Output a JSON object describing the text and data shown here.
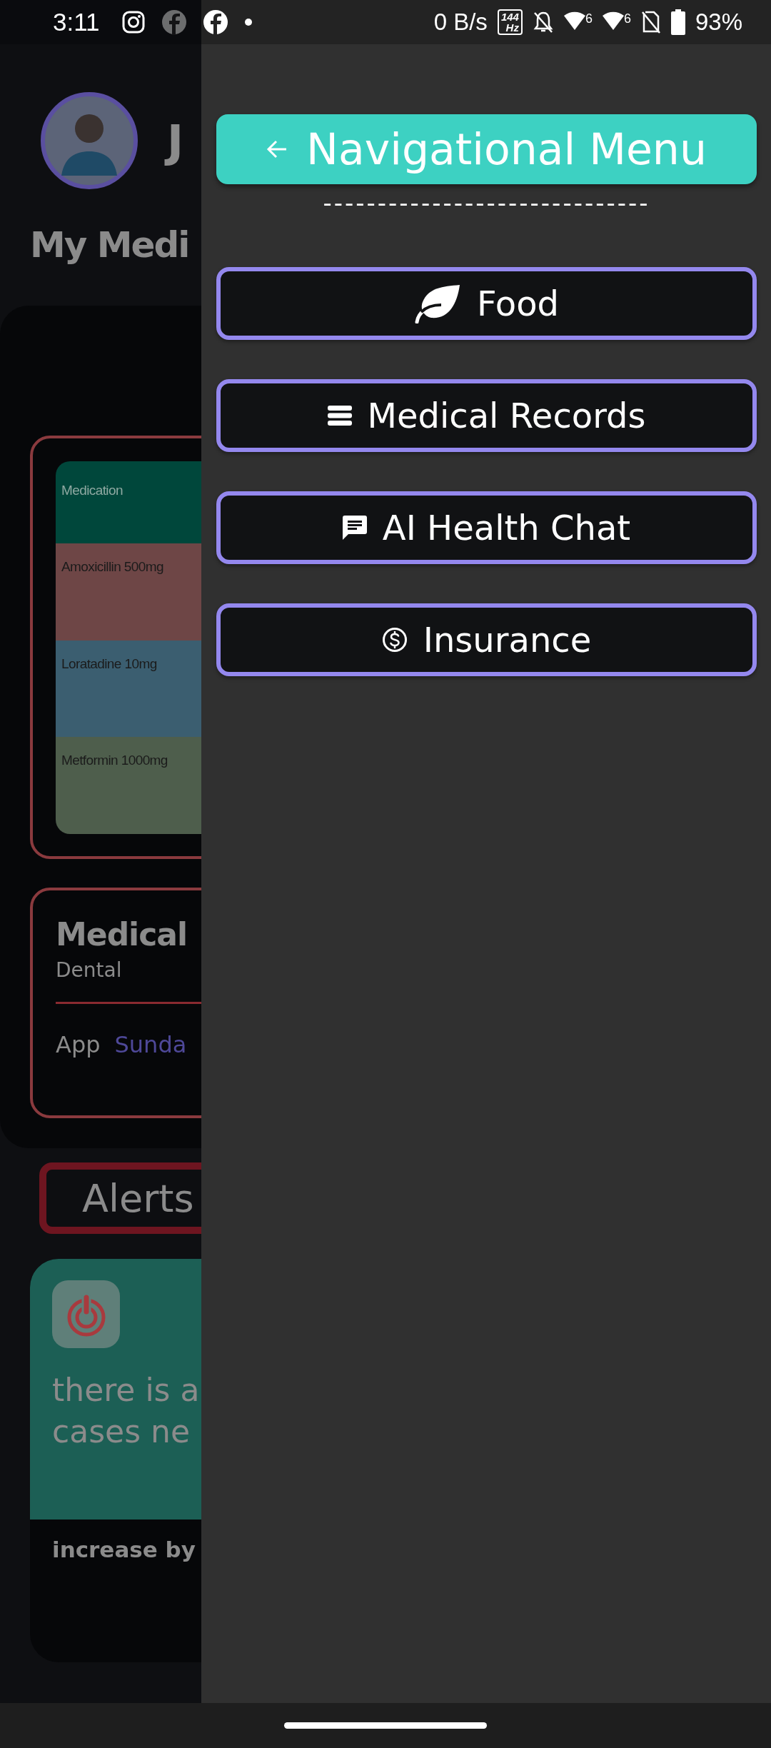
{
  "status_bar": {
    "time": "3:11",
    "notifications": [
      {
        "kind": "instagram",
        "dimmed": false
      },
      {
        "kind": "facebook",
        "dimmed": true
      },
      {
        "kind": "facebook",
        "dimmed": false
      },
      {
        "kind": "dot",
        "dimmed": false
      }
    ],
    "net_speed": "0 B/s",
    "refresh_rate": {
      "value": "144",
      "unit": "Hz"
    },
    "wifi": [
      {
        "badge": "6"
      },
      {
        "badge": "6"
      }
    ],
    "battery": "93%"
  },
  "background_page": {
    "user_name": "J",
    "section_title": "My Medi",
    "medication_table": {
      "header": "Medication",
      "rows": [
        {
          "name": "Amoxicillin 500mg",
          "color": "#6e4646"
        },
        {
          "name": "Loratadine 10mg",
          "color": "#3b5e70"
        },
        {
          "name": "Metformin 1000mg",
          "color": "#4e5e4c"
        }
      ]
    },
    "appointment": {
      "title": "Medical",
      "type": "Dental",
      "label": "App",
      "day": "Sunda"
    },
    "alerts": {
      "title": "Alerts",
      "message_lines": [
        "there is a",
        "cases ne"
      ],
      "footer": "increase by"
    }
  },
  "drawer": {
    "header": {
      "title": "Navigational Menu"
    },
    "divider_text": "------------------------------",
    "items": [
      {
        "label": "Food",
        "kind": "leaf"
      },
      {
        "label": "Medical Records",
        "kind": "records"
      },
      {
        "label": "AI Health Chat",
        "kind": "chat"
      },
      {
        "label": "Insurance",
        "kind": "dollar"
      }
    ]
  }
}
